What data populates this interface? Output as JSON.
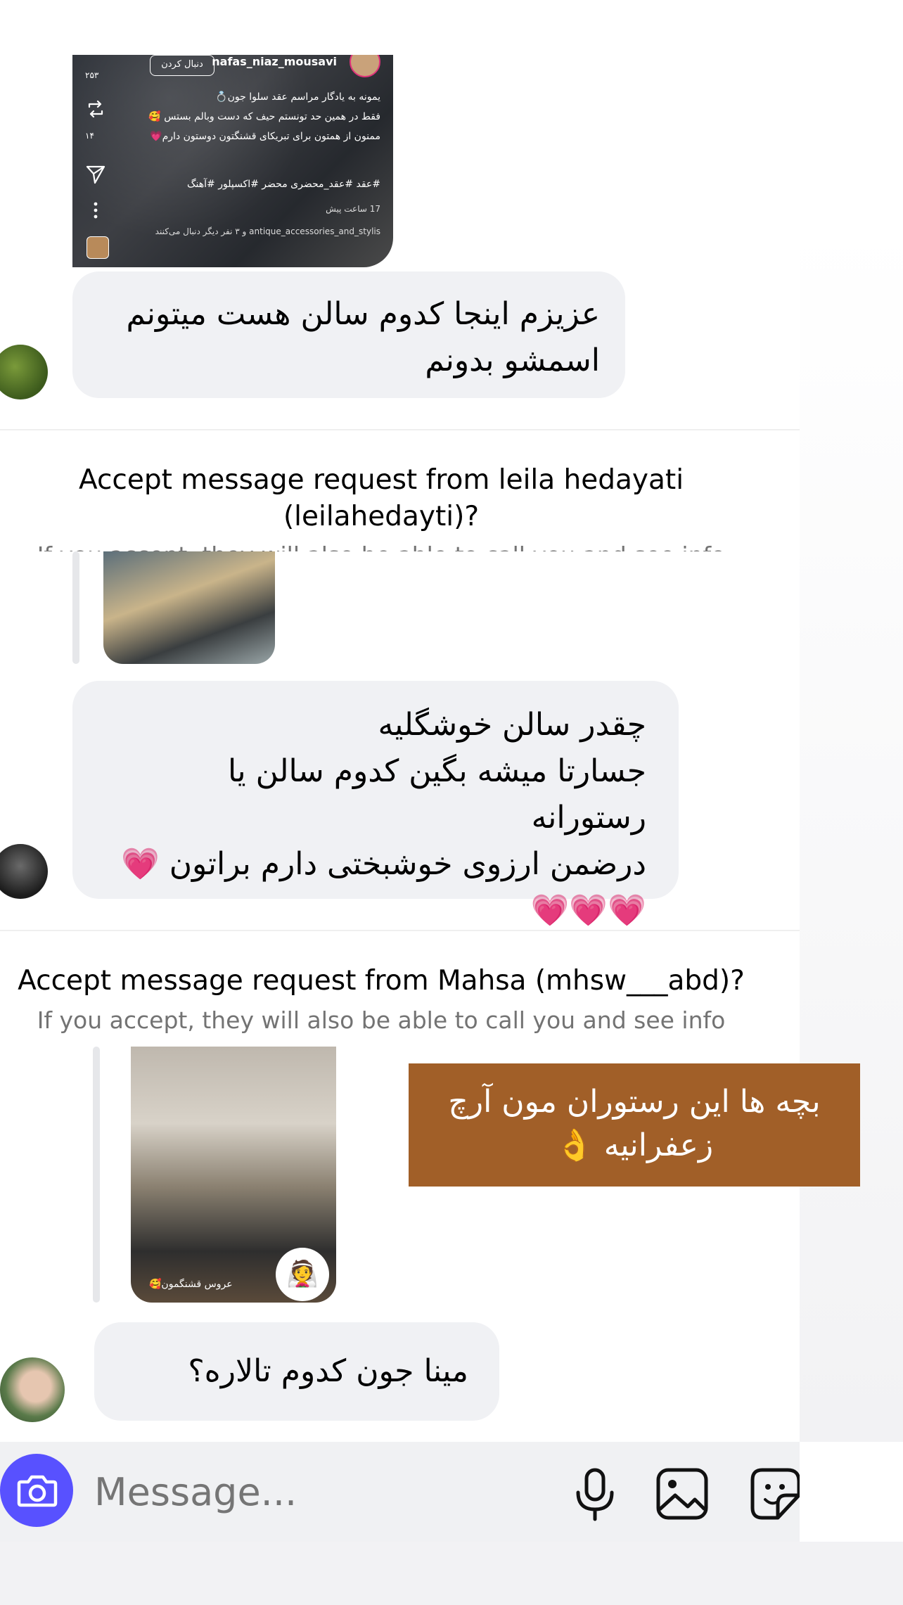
{
  "shared_post": {
    "username": "nafas_niaz_mousavi",
    "follow_label": "دنبال کردن",
    "caption_lines": [
      "یمونه به یادگار مراسم عقد سلوا جون💍",
      "فقط در همین حد تونستم حیف که دست وبالم بستس 🥰",
      "ممنون از همتون برای تبریکای قشنگتون دوستون دارم💗"
    ],
    "hashtags": "#عقد #عقد_محضری محضر #اکسپلور #آهنگ",
    "time_ago": "17 ساعت پیش",
    "likes_text": "antique_accessories_and_stylis و ۳ نفر دیگر دنبال می‌کنند",
    "side_counts": [
      "۲۵۳",
      "۱۴"
    ],
    "colors": {
      "ring": "#e0337a"
    }
  },
  "messages": [
    {
      "text": "عزیزم اینجا کدوم سالن هست میتونم اسمشو بدونم"
    },
    {
      "text_lines": [
        "چقدر سالن خوشگلیه",
        "جسارتا میشه بگین کدوم سالن یا رستورانه",
        "درضمن ارزوی خوشبختی دارم براتون 💗",
        "💗💗💗"
      ]
    },
    {
      "text": "مینا جون کدوم تالاره؟"
    }
  ],
  "requests": [
    {
      "title_line1": "Accept message request from leila hedayati",
      "title_line2": "(leilahedayti)?",
      "subtitle": "If you accept, they will also be able to call you and see info"
    },
    {
      "title_line1": "Accept message request from Mahsa (mhsw___abd)?",
      "subtitle": "If you accept, they will also be able to call you and see info"
    }
  ],
  "story_reply": {
    "text_line1": "بچه ها این رستوران مون آرچ",
    "text_line2": "زعفرانیه 👌",
    "color": "#a15f28"
  },
  "story_thumb_caption": "عروس قشنگمون🥰",
  "composer": {
    "placeholder": "Message...",
    "camera_color": "#5851ff",
    "icons": [
      "camera-icon",
      "microphone-icon",
      "gallery-icon",
      "sticker-icon"
    ]
  }
}
